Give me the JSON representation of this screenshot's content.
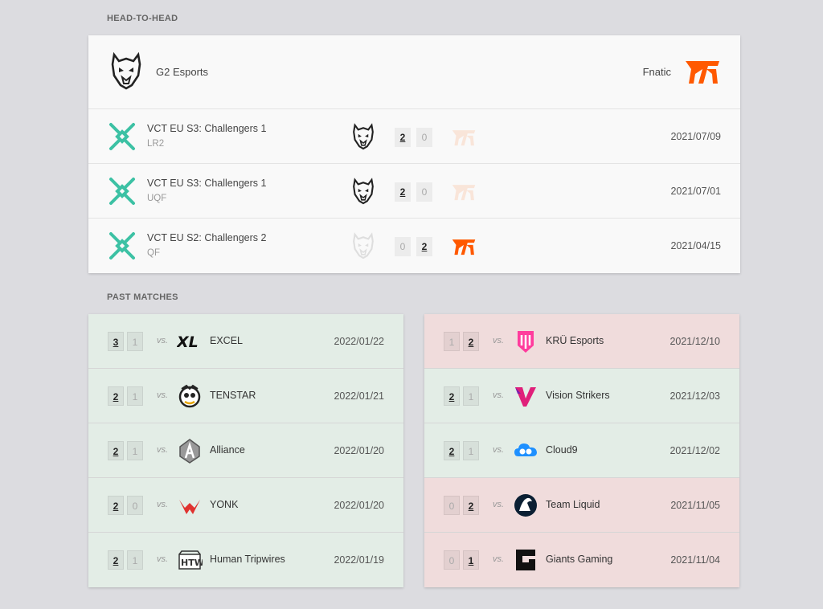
{
  "sections": {
    "h2h_label": "HEAD-TO-HEAD",
    "past_label": "PAST MATCHES"
  },
  "head_to_head": {
    "team_a": {
      "name": "G2 Esports",
      "icon": "g2-logo"
    },
    "team_b": {
      "name": "Fnatic",
      "icon": "fnatic-logo",
      "color": "#ff5900"
    },
    "event_icon_color": "#3cc1a4",
    "matches": [
      {
        "event": "VCT EU S3: Challengers 1",
        "round": "LR2",
        "score_a": "2",
        "score_b": "0",
        "winner": "a",
        "date": "2021/07/09"
      },
      {
        "event": "VCT EU S3: Challengers 1",
        "round": "UQF",
        "score_a": "2",
        "score_b": "0",
        "winner": "a",
        "date": "2021/07/01"
      },
      {
        "event": "VCT EU S2: Challengers 2",
        "round": "QF",
        "score_a": "0",
        "score_b": "2",
        "winner": "b",
        "date": "2021/04/15"
      }
    ]
  },
  "past_matches": {
    "vs_label": "vs.",
    "left": [
      {
        "s1": "3",
        "s2": "1",
        "opponent": "EXCEL",
        "icon": "excel-logo",
        "date": "2022/01/22",
        "result": "win"
      },
      {
        "s1": "2",
        "s2": "1",
        "opponent": "TENSTAR",
        "icon": "tenstar-logo",
        "date": "2022/01/21",
        "result": "win"
      },
      {
        "s1": "2",
        "s2": "1",
        "opponent": "Alliance",
        "icon": "alliance-logo",
        "date": "2022/01/20",
        "result": "win"
      },
      {
        "s1": "2",
        "s2": "0",
        "opponent": "YONK",
        "icon": "yonk-logo",
        "date": "2022/01/20",
        "result": "win"
      },
      {
        "s1": "2",
        "s2": "1",
        "opponent": "Human Tripwires",
        "icon": "human-tripwires-logo",
        "date": "2022/01/19",
        "result": "win"
      }
    ],
    "right": [
      {
        "s1": "1",
        "s2": "2",
        "opponent": "KRÜ Esports",
        "icon": "kru-logo",
        "date": "2021/12/10",
        "result": "loss"
      },
      {
        "s1": "2",
        "s2": "1",
        "opponent": "Vision Strikers",
        "icon": "vision-strikers-logo",
        "date": "2021/12/03",
        "result": "win"
      },
      {
        "s1": "2",
        "s2": "1",
        "opponent": "Cloud9",
        "icon": "cloud9-logo",
        "date": "2021/12/02",
        "result": "win"
      },
      {
        "s1": "0",
        "s2": "2",
        "opponent": "Team Liquid",
        "icon": "team-liquid-logo",
        "date": "2021/11/05",
        "result": "loss"
      },
      {
        "s1": "0",
        "s2": "1",
        "opponent": "Giants Gaming",
        "icon": "giants-gaming-logo",
        "date": "2021/11/04",
        "result": "loss"
      }
    ]
  }
}
